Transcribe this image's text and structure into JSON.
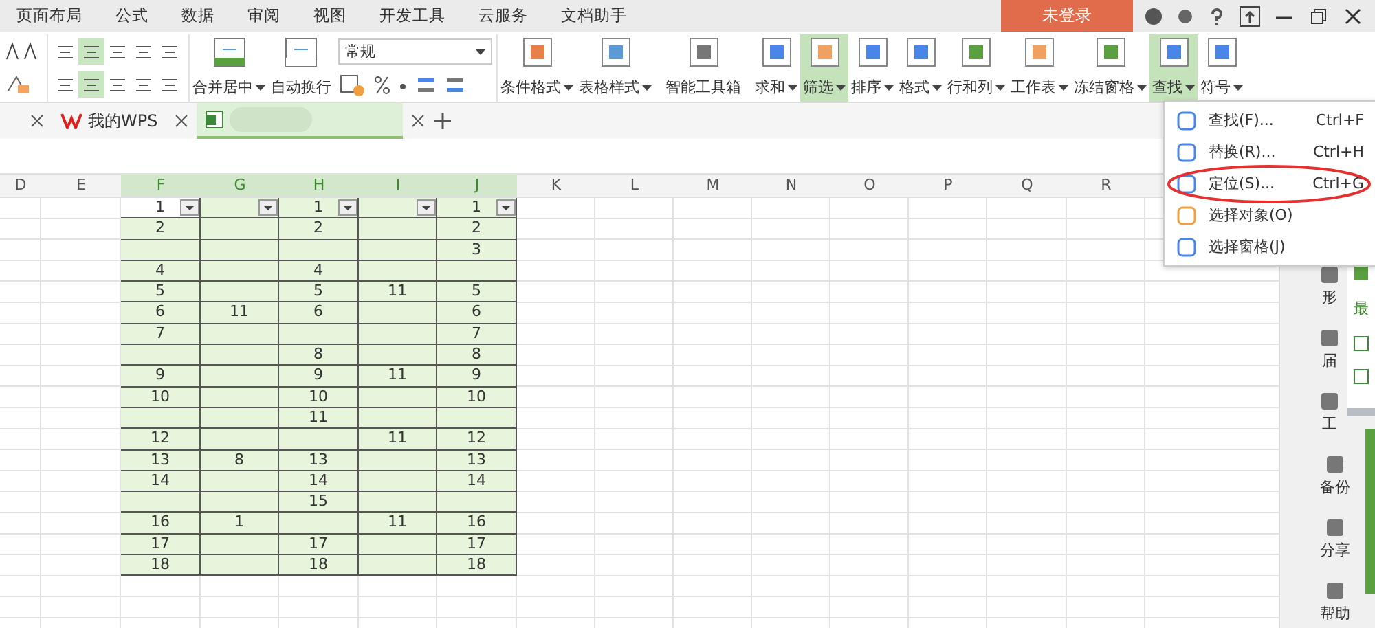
{
  "menu_tabs": [
    "页面布局",
    "公式",
    "数据",
    "审阅",
    "视图",
    "开发工具",
    "云服务",
    "文档助手"
  ],
  "login_button": "未登录",
  "ribbon": {
    "number_format": "常规",
    "buttons": [
      {
        "label": "合并居中",
        "dropdown": true,
        "selected": false
      },
      {
        "label": "自动换行",
        "dropdown": false,
        "selected": false
      },
      {
        "label": "条件格式",
        "dropdown": true,
        "selected": false
      },
      {
        "label": "表格样式",
        "dropdown": true,
        "selected": false
      },
      {
        "label": "智能工具箱",
        "dropdown": false,
        "selected": false
      },
      {
        "label": "求和",
        "dropdown": true,
        "selected": false
      },
      {
        "label": "筛选",
        "dropdown": true,
        "selected": true
      },
      {
        "label": "排序",
        "dropdown": true,
        "selected": false
      },
      {
        "label": "格式",
        "dropdown": true,
        "selected": false
      },
      {
        "label": "行和列",
        "dropdown": true,
        "selected": false
      },
      {
        "label": "工作表",
        "dropdown": true,
        "selected": false
      },
      {
        "label": "冻结窗格",
        "dropdown": true,
        "selected": false
      },
      {
        "label": "查找",
        "dropdown": true,
        "selected": true
      },
      {
        "label": "符号",
        "dropdown": true,
        "selected": false
      }
    ]
  },
  "doc_tabs": [
    {
      "label": "我的WPS",
      "selected": false
    },
    {
      "selected": true
    }
  ],
  "columns": [
    {
      "label": "D",
      "selected": false
    },
    {
      "label": "E",
      "selected": false
    },
    {
      "label": "F",
      "selected": true
    },
    {
      "label": "G",
      "selected": true
    },
    {
      "label": "H",
      "selected": true
    },
    {
      "label": "I",
      "selected": true
    },
    {
      "label": "J",
      "selected": true
    },
    {
      "label": "K",
      "selected": false
    },
    {
      "label": "L",
      "selected": false
    },
    {
      "label": "M",
      "selected": false
    },
    {
      "label": "N",
      "selected": false
    },
    {
      "label": "O",
      "selected": false
    },
    {
      "label": "P",
      "selected": false
    },
    {
      "label": "Q",
      "selected": false
    },
    {
      "label": "R",
      "selected": false
    }
  ],
  "rows": [
    [
      "1",
      "",
      "1",
      "",
      "1"
    ],
    [
      "2",
      "",
      "2",
      "",
      "2"
    ],
    [
      "",
      "",
      "",
      "",
      "3"
    ],
    [
      "4",
      "",
      "4",
      "",
      ""
    ],
    [
      "5",
      "",
      "5",
      "11",
      "5"
    ],
    [
      "6",
      "11",
      "6",
      "",
      "6"
    ],
    [
      "7",
      "",
      "",
      "",
      "7"
    ],
    [
      "",
      "",
      "8",
      "",
      "8"
    ],
    [
      "9",
      "",
      "9",
      "11",
      "9"
    ],
    [
      "10",
      "",
      "10",
      "",
      "10"
    ],
    [
      "",
      "",
      "11",
      "",
      ""
    ],
    [
      "12",
      "",
      "",
      "11",
      "12"
    ],
    [
      "13",
      "8",
      "13",
      "",
      "13"
    ],
    [
      "14",
      "",
      "14",
      "",
      "14"
    ],
    [
      "",
      "",
      "15",
      "",
      ""
    ],
    [
      "16",
      "1",
      "",
      "11",
      "16"
    ],
    [
      "17",
      "",
      "17",
      "",
      "17"
    ],
    [
      "18",
      "",
      "18",
      "",
      "18"
    ]
  ],
  "find_menu": [
    {
      "label": "查找(F)...",
      "shortcut": "Ctrl+F",
      "circled": false
    },
    {
      "label": "替换(R)...",
      "shortcut": "Ctrl+H",
      "circled": false
    },
    {
      "label": "定位(S)...",
      "shortcut": "Ctrl+G",
      "circled": true
    },
    {
      "label": "选择对象(O)",
      "circled": false
    },
    {
      "label": "选择窗格(J)",
      "circled": false
    }
  ],
  "side_panel": [
    "形",
    "届",
    "工",
    "备份",
    "分享",
    "帮助"
  ],
  "side_popup": {
    "title": "最"
  }
}
